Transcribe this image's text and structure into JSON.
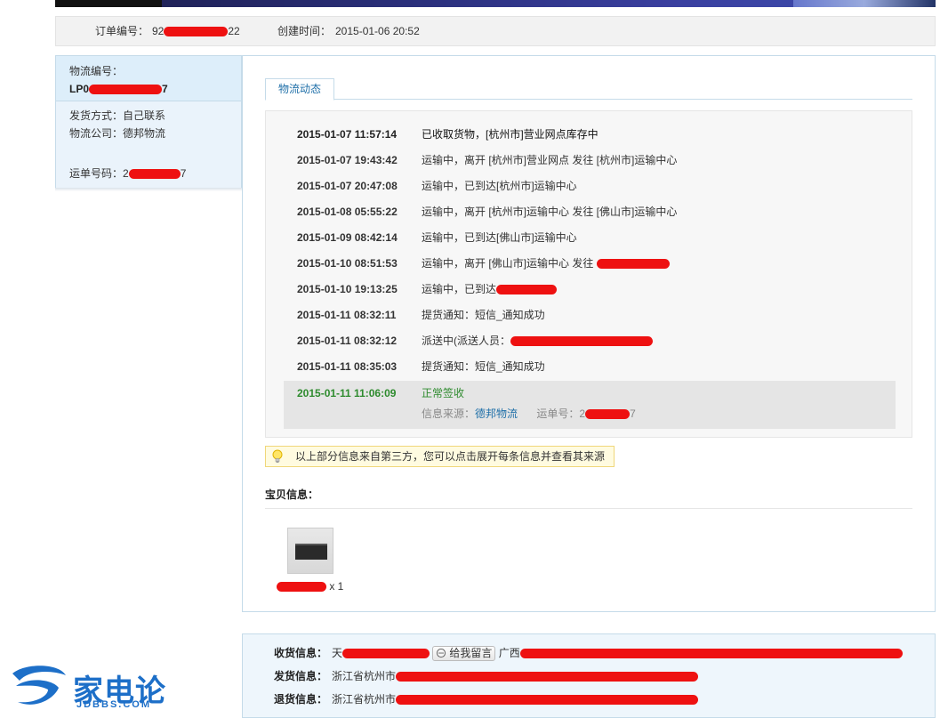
{
  "order_bar": {
    "order_no_label": "订单编号：",
    "order_no_prefix": "92",
    "order_no_suffix": "22",
    "create_label": "创建时间：",
    "create_time": "2015-01-06 20:52"
  },
  "left_panel": {
    "logistics_no_label": "物流编号：",
    "logistics_no_prefix": "LP0",
    "logistics_no_suffix": "7",
    "ship_method": "发货方式：自己联系",
    "carrier": "物流公司：德邦物流",
    "waybill_label": "运单号码：",
    "waybill_prefix": "2",
    "waybill_suffix": "7"
  },
  "tab": {
    "label": "物流动态"
  },
  "tracking": [
    {
      "time": "2015-01-07 11:57:14",
      "desc": "已收取货物，[杭州市]营业网点库存中"
    },
    {
      "time": "2015-01-07 19:43:42",
      "desc": "运输中，离开 [杭州市]营业网点 发往 [杭州市]运输中心"
    },
    {
      "time": "2015-01-07 20:47:08",
      "desc": "运输中，已到达[杭州市]运输中心"
    },
    {
      "time": "2015-01-08 05:55:22",
      "desc": "运输中，离开 [杭州市]运输中心 发往 [佛山市]运输中心"
    },
    {
      "time": "2015-01-09 08:42:14",
      "desc": "运输中，已到达[佛山市]运输中心"
    },
    {
      "time": "2015-01-10 08:51:53",
      "desc": "运输中，离开 [佛山市]运输中心 发往 "
    },
    {
      "time": "2015-01-10 19:13:25",
      "desc": "运输中，已到达"
    },
    {
      "time": "2015-01-11 08:32:11",
      "desc": "提货通知：短信_通知成功"
    },
    {
      "time": "2015-01-11 08:32:12",
      "desc": "派送中(派送人员："
    },
    {
      "time": "2015-01-11 08:35:03",
      "desc": "提货通知：短信_通知成功"
    }
  ],
  "tracking_final": {
    "time": "2015-01-11 11:06:09",
    "desc": "正常签收",
    "source_label": "信息来源：",
    "source_value": "德邦物流",
    "waybill_label": "运单号：",
    "waybill_prefix": "2",
    "waybill_suffix": "7"
  },
  "notice": "以上部分信息来自第三方，您可以点击展开每条信息并查看其来源",
  "item_section": {
    "heading": "宝贝信息：",
    "qty": "x 1"
  },
  "address": {
    "receive_label": "收货信息：",
    "receive_prefix": "天",
    "message_button": "给我留言",
    "receive_region": "广西",
    "send_label": "发货信息：",
    "send_value": "浙江省杭州市",
    "return_label": "退货信息：",
    "return_value": "浙江省杭州市"
  },
  "forum_logo": {
    "name_cn": "家电论坛",
    "name_en": "JDBBS.COM"
  },
  "colors": {
    "accent_blue": "#1f6fa8",
    "success_green": "#2e8b2e",
    "panel_border": "#c5dbe9",
    "redaction": "#ee1111"
  }
}
